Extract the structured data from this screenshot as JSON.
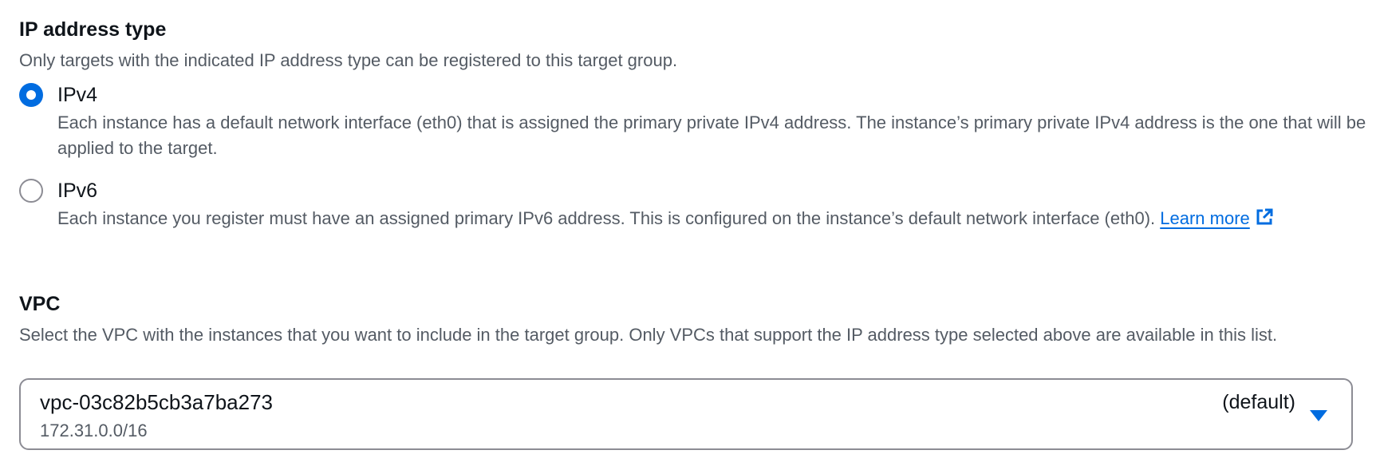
{
  "ip_address_type": {
    "title": "IP address type",
    "description": "Only targets with the indicated IP address type can be registered to this target group.",
    "options": [
      {
        "label": "IPv4",
        "selected": true,
        "description": "Each instance has a default network interface (eth0) that is assigned the primary private IPv4 address. The instance’s primary private IPv4 address is the one that will be applied to the target."
      },
      {
        "label": "IPv6",
        "selected": false,
        "description": "Each instance you register must have an assigned primary IPv6 address. This is configured on the instance’s default network interface (eth0).",
        "link_text": "Learn more",
        "link_icon": "external-link-icon"
      }
    ]
  },
  "vpc": {
    "title": "VPC",
    "description": "Select the VPC with the instances that you want to include in the target group. Only VPCs that support the IP address type selected above are available in this list.",
    "select": {
      "value": "vpc-03c82b5cb3a7ba273",
      "sub_value": "172.31.0.0/16",
      "tag": "(default)",
      "icon": "caret-down-icon"
    }
  },
  "colors": {
    "accent": "#006ce0",
    "text": "#0f141a",
    "secondary_text": "#545b64",
    "border": "#8c8c94"
  }
}
